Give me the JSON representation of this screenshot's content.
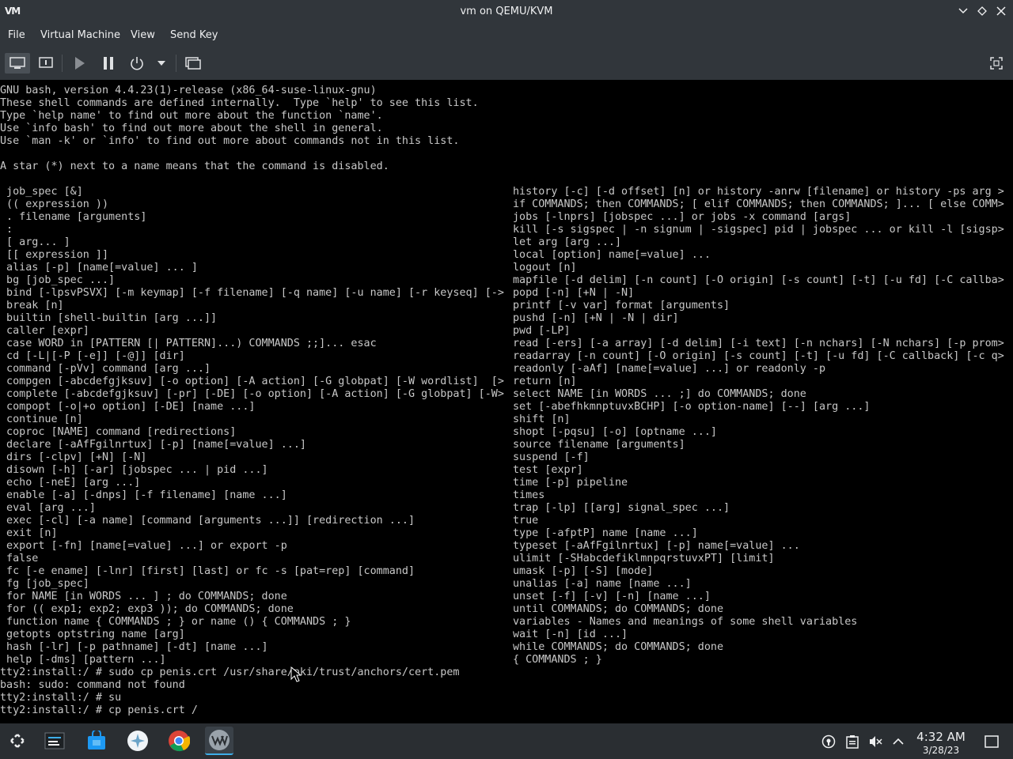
{
  "window": {
    "app_logo": "VM",
    "title": "vm on QEMU/KVM"
  },
  "menu": {
    "items": [
      "File",
      "Virtual Machine",
      "View",
      "Send Key"
    ]
  },
  "toolbar": {
    "buttons": [
      "console-view-icon",
      "details-view-icon",
      "run-icon",
      "pause-icon",
      "shutdown-icon",
      "dropdown-arrow-icon",
      "screenshot-icon",
      "fullscreen-icon"
    ]
  },
  "terminal": {
    "header_lines": [
      "GNU bash, version 4.4.23(1)-release (x86_64-suse-linux-gnu)",
      "These shell commands are defined internally.  Type `help' to see this list.",
      "Type `help name' to find out more about the function `name'.",
      "Use `info bash' to find out more about the shell in general.",
      "Use `man -k' or `info' to find out more about commands not in this list.",
      "",
      "A star (*) next to a name means that the command is disabled.",
      ""
    ],
    "left_column": [
      " job_spec [&]",
      " (( expression ))",
      " . filename [arguments]",
      " :",
      " [ arg... ]",
      " [[ expression ]]",
      " alias [-p] [name[=value] ... ]",
      " bg [job_spec ...]",
      " bind [-lpsvPSVX] [-m keymap] [-f filename] [-q name] [-u name] [-r keyseq] [->",
      " break [n]",
      " builtin [shell-builtin [arg ...]]",
      " caller [expr]",
      " case WORD in [PATTERN [| PATTERN]...) COMMANDS ;;]... esac",
      " cd [-L|[-P [-e]] [-@]] [dir]",
      " command [-pVv] command [arg ...]",
      " compgen [-abcdefgjksuv] [-o option] [-A action] [-G globpat] [-W wordlist]  [>",
      " complete [-abcdefgjksuv] [-pr] [-DE] [-o option] [-A action] [-G globpat] [-W>",
      " compopt [-o|+o option] [-DE] [name ...]",
      " continue [n]",
      " coproc [NAME] command [redirections]",
      " declare [-aAfFgilnrtux] [-p] [name[=value] ...]",
      " dirs [-clpv] [+N] [-N]",
      " disown [-h] [-ar] [jobspec ... | pid ...]",
      " echo [-neE] [arg ...]",
      " enable [-a] [-dnps] [-f filename] [name ...]",
      " eval [arg ...]",
      " exec [-cl] [-a name] [command [arguments ...]] [redirection ...]",
      " exit [n]",
      " export [-fn] [name[=value] ...] or export -p",
      " false",
      " fc [-e ename] [-lnr] [first] [last] or fc -s [pat=rep] [command]",
      " fg [job_spec]",
      " for NAME [in WORDS ... ] ; do COMMANDS; done",
      " for (( exp1; exp2; exp3 )); do COMMANDS; done",
      " function name { COMMANDS ; } or name () { COMMANDS ; }",
      " getopts optstring name [arg]",
      " hash [-lr] [-p pathname] [-dt] [name ...]",
      " help [-dms] [pattern ...]"
    ],
    "right_column": [
      "history [-c] [-d offset] [n] or history -anrw [filename] or history -ps arg >",
      "if COMMANDS; then COMMANDS; [ elif COMMANDS; then COMMANDS; ]... [ else COMM>",
      "jobs [-lnprs] [jobspec ...] or jobs -x command [args]",
      "kill [-s sigspec | -n signum | -sigspec] pid | jobspec ... or kill -l [sigsp>",
      "let arg [arg ...]",
      "local [option] name[=value] ...",
      "logout [n]",
      "mapfile [-d delim] [-n count] [-O origin] [-s count] [-t] [-u fd] [-C callba>",
      "popd [-n] [+N | -N]",
      "printf [-v var] format [arguments]",
      "pushd [-n] [+N | -N | dir]",
      "pwd [-LP]",
      "read [-ers] [-a array] [-d delim] [-i text] [-n nchars] [-N nchars] [-p prom>",
      "readarray [-n count] [-O origin] [-s count] [-t] [-u fd] [-C callback] [-c q>",
      "readonly [-aAf] [name[=value] ...] or readonly -p",
      "return [n]",
      "select NAME [in WORDS ... ;] do COMMANDS; done",
      "set [-abefhkmnptuvxBCHP] [-o option-name] [--] [arg ...]",
      "shift [n]",
      "shopt [-pqsu] [-o] [optname ...]",
      "source filename [arguments]",
      "suspend [-f]",
      "test [expr]",
      "time [-p] pipeline",
      "times",
      "trap [-lp] [[arg] signal_spec ...]",
      "true",
      "type [-afptP] name [name ...]",
      "typeset [-aAfFgilnrtux] [-p] name[=value] ...",
      "ulimit [-SHabcdefiklmnpqrstuvxPT] [limit]",
      "umask [-p] [-S] [mode]",
      "unalias [-a] name [name ...]",
      "unset [-f] [-v] [-n] [name ...]",
      "until COMMANDS; do COMMANDS; done",
      "variables - Names and meanings of some shell variables",
      "wait [-n] [id ...]",
      "while COMMANDS; do COMMANDS; done",
      "{ COMMANDS ; }"
    ],
    "footer_lines": [
      "tty2:install:/ # sudo cp penis.crt /usr/share/pki/trust/anchors/cert.pem",
      "bash: sudo: command not found",
      "tty2:install:/ # su",
      "tty2:install:/ # cp penis.crt /"
    ]
  },
  "taskbar": {
    "apps": [
      "app-launcher-icon",
      "task-manager-icon",
      "discover-store-icon",
      "settings-app-icon",
      "chrome-icon",
      "virt-manager-icon"
    ],
    "tray": [
      "vault-icon",
      "clipboard-icon",
      "volume-muted-icon",
      "tray-expand-icon",
      "show-desktop-icon"
    ],
    "clock_time": "4:32 AM",
    "clock_date": "3/28/23"
  },
  "colors": {
    "chrome_bg": "#31363b",
    "terminal_fg": "#c8c8c8",
    "terminal_bg": "#000000",
    "taskbar_bg": "#2a2e32",
    "accent": "#3daee9"
  }
}
